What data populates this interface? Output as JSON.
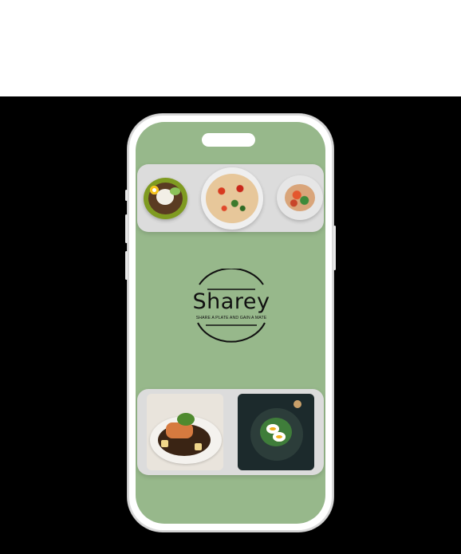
{
  "app": {
    "name": "Sharey",
    "tagline": "SHARE A PLATE AND GAIN A MATE"
  },
  "top_carousel": {
    "items": [
      {
        "icon": "rice-bowl-dish-photo"
      },
      {
        "icon": "pasta-dish-photo"
      },
      {
        "icon": "salad-dish-photo"
      }
    ]
  },
  "bottom_gallery": {
    "items": [
      {
        "icon": "salmon-dish-photo"
      },
      {
        "icon": "egg-salad-dish-photo"
      }
    ]
  },
  "colors": {
    "screen_background": "#97b88b",
    "card_background": "#dcdcdc",
    "phone_frame": "#ffffff"
  }
}
